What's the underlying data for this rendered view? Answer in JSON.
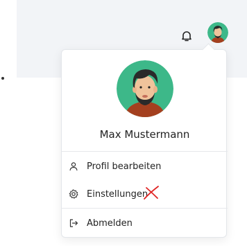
{
  "user": {
    "name": "Max Mustermann"
  },
  "menu": {
    "items": [
      {
        "label": "Profil bearbeiten",
        "icon": "user-icon"
      },
      {
        "label": "Einstellungen",
        "icon": "gear-icon"
      },
      {
        "label": "Abmelden",
        "icon": "logout-icon"
      }
    ]
  },
  "header": {
    "notifications_icon": "bell-icon"
  },
  "colors": {
    "avatar_bg": "#3db889",
    "topbar_bg": "#f2f4f7",
    "annotation_red": "#e02424"
  }
}
